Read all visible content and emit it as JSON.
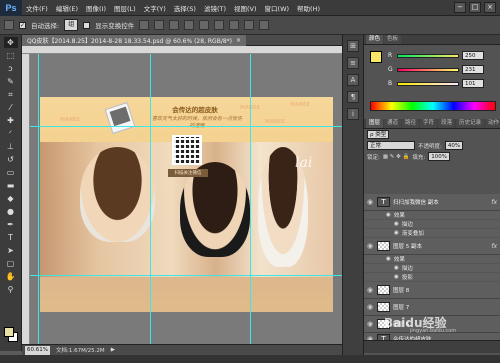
{
  "app": {
    "logo": "Ps"
  },
  "menubar": {
    "items": [
      "文件(F)",
      "编辑(E)",
      "图像(I)",
      "图层(L)",
      "文字(Y)",
      "选择(S)",
      "滤镜(T)",
      "视图(V)",
      "窗口(W)",
      "帮助(H)"
    ],
    "window_controls": [
      "−",
      "□",
      "×"
    ]
  },
  "options": {
    "auto_select_label": "自动选择:",
    "auto_select_checked": true,
    "auto_select_value": "组",
    "show_transform_label": "显示变换控件",
    "show_transform_checked": false
  },
  "document": {
    "tab_title": "QQ皮肤【2014.8.25】2014-8-28 18.33.54.psd @ 60.6% (28, RGB/8*)",
    "close_glyph": "×",
    "image": {
      "title": "会传达的超皮肤",
      "slogan": "喜欢天气太好的时候，依然会有一点忧伤的温暖",
      "qr_caption": "扫描关注微信",
      "script_text": "lai",
      "watermarks": [
        "MANEE",
        "MANEE",
        "MANEE",
        "MANEE"
      ]
    }
  },
  "status": {
    "zoom": "60.61%",
    "doc_info": "文档:1.67M/25.2M"
  },
  "color_panel": {
    "tabs": [
      "颜色",
      "色板"
    ],
    "r": {
      "label": "R",
      "value": "250"
    },
    "g": {
      "label": "G",
      "value": "231"
    },
    "b": {
      "label": "B",
      "value": "101"
    },
    "fg_color": "#fae765"
  },
  "layers_panel": {
    "tabs": [
      "图层",
      "通道",
      "路径",
      "字符",
      "段落",
      "历史记录",
      "动作",
      "调整"
    ],
    "filter_label": "ρ 类型",
    "blend_mode": "正常",
    "opacity_label": "不透明度:",
    "opacity_value": "40%",
    "lock_label": "锁定:",
    "fill_label": "填充:",
    "fill_value": "100%",
    "layers": [
      {
        "name": "扫扫加我微信 副本",
        "type": "text",
        "fx": "fx"
      },
      {
        "effect_header": "效果"
      },
      {
        "effect": "描边"
      },
      {
        "effect": "渐变叠加"
      },
      {
        "name": "图层 5 副本",
        "type": "image",
        "fx": "fx"
      },
      {
        "effect_header": "效果"
      },
      {
        "effect": "描边"
      },
      {
        "effect": "投影"
      },
      {
        "name": "图层 8",
        "type": "image"
      },
      {
        "name": "图层 7",
        "type": "image"
      },
      {
        "name": "图层 6",
        "type": "image"
      },
      {
        "name": "会传达的超皮肤",
        "type": "text"
      }
    ]
  },
  "watermark": {
    "text": "Baidu经验",
    "sub": "jingyan.baidu.com"
  }
}
